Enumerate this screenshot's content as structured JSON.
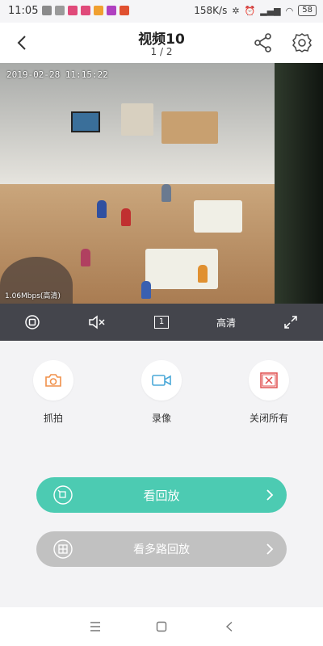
{
  "status_bar": {
    "time": "11:05",
    "speed": "158K/s",
    "battery": "58"
  },
  "header": {
    "title": "视频10",
    "page_indicator": "1 / 2"
  },
  "video": {
    "timestamp": "2019-02-28 11:15:22",
    "bitrate": "1.06Mbps(高清)"
  },
  "controls": {
    "quality_label": "高清",
    "split_label": "1"
  },
  "actions": [
    {
      "label": "抓拍",
      "icon": "camera-icon"
    },
    {
      "label": "录像",
      "icon": "video-record-icon"
    },
    {
      "label": "关闭所有",
      "icon": "close-all-icon"
    }
  ],
  "buttons": {
    "playback_label": "看回放",
    "multi_playback_label": "看多路回放"
  },
  "colors": {
    "accent": "#4ccbb2",
    "control_bar": "#44454c",
    "disabled_button": "#c1c1c1",
    "action_icon": "#f0904a",
    "record_icon": "#4aa8d8",
    "close_icon": "#e05050"
  }
}
